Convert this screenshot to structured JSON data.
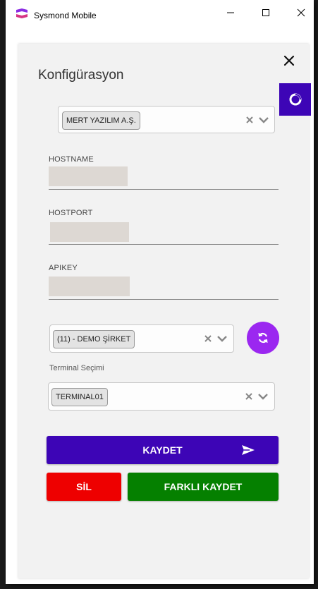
{
  "window": {
    "title": "Sysmond Mobile",
    "icons": {
      "logo": "sysmond-logo-icon",
      "minimize": "minimize-icon",
      "maximize": "maximize-icon",
      "close": "close-icon"
    }
  },
  "page": {
    "title": "Konfigürasyon",
    "close_icon": "close-x-icon",
    "side_button_icon": "loading-ring-icon"
  },
  "company_select": {
    "value": "MERT YAZILIM A.Ş.",
    "clear_icon": "clear-x-icon",
    "arrow_icon": "chevron-down-icon"
  },
  "fields": {
    "hostname": {
      "label": "HOSTNAME",
      "value": ""
    },
    "hostport": {
      "label": "HOSTPORT",
      "value": ""
    },
    "apikey": {
      "label": "APIKEY",
      "value": ""
    }
  },
  "firm_select": {
    "value": "(11) - DEMO ŞİRKET",
    "refresh_icon": "refresh-sync-icon"
  },
  "terminal": {
    "label": "Terminal Seçimi",
    "value": "TERMINAL01"
  },
  "buttons": {
    "save": "KAYDET",
    "save_icon": "send-arrow-icon",
    "delete": "SİL",
    "save_as": "FARKLI KAYDET"
  },
  "colors": {
    "primary": "#3d05b6",
    "accent": "#9b27f0",
    "danger": "#ee0000",
    "success": "#058000"
  }
}
